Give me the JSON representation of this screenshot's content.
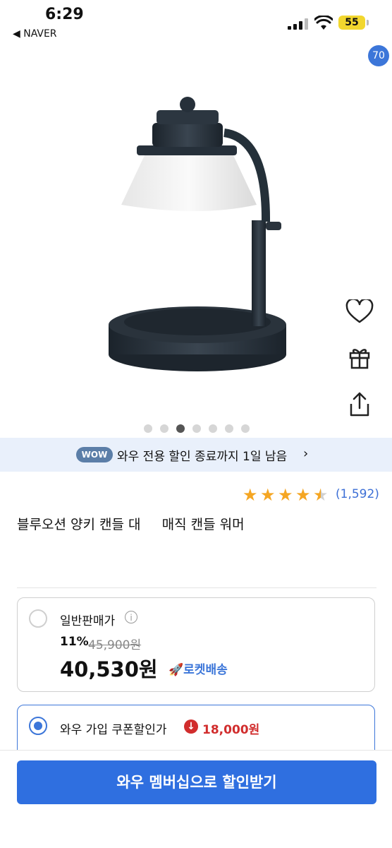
{
  "status_bar": {
    "time": "6:29",
    "back_app": "◀ NAVER",
    "battery": "55"
  },
  "top_bar": {
    "cart_count": "70",
    "icons": [
      "back-chevron-icon",
      "search-icon",
      "home-icon",
      "cart-icon"
    ]
  },
  "product_image": {
    "description_icon": "candle-warmer-lamp",
    "carousel": {
      "count": 7,
      "active_index": 2
    }
  },
  "side_actions": [
    "heart-icon",
    "gift-icon",
    "share-icon"
  ],
  "wow_banner": {
    "pill": "WOW",
    "text": "와우 전용 할인 종료까지 1일 남음",
    "chevron": "›"
  },
  "rating": {
    "stars": 4.5,
    "reviews": "(1,592)"
  },
  "product_title": "블루오션 양키 캔들 대     매직 캔들 워머",
  "regular_price_card": {
    "label": "일반판매가",
    "info_icon": "i",
    "discount": "11%",
    "original_price": "45,900원",
    "price": "40,530원",
    "delivery": "로켓배송"
  },
  "coupon_card": {
    "label": "와우 가입 쿠폰할인가",
    "icon": "↓",
    "price": "18,000원"
  },
  "cta": {
    "label": "와우 멤버십으로 할인받기"
  },
  "colors": {
    "accent": "#2f6fe0",
    "star": "#f5a623",
    "discount_red": "#d12d2d",
    "wow_bg": "#e9f0fb"
  }
}
